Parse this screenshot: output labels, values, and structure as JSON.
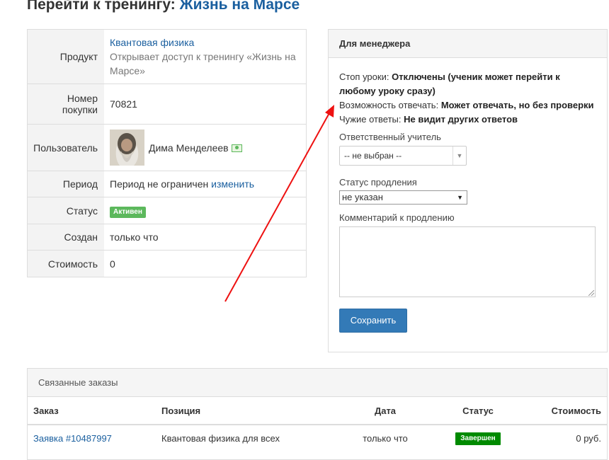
{
  "title": {
    "prefix": "Перейти к тренингу:",
    "link": "Жизнь на Марсе"
  },
  "info": {
    "product_label": "Продукт",
    "product_link": "Квантовая физика",
    "product_desc": "Открывает доступ к тренингу «Жизнь на Марсе»",
    "number_label": "Номер покупки",
    "number_value": "70821",
    "user_label": "Пользователь",
    "user_name": "Дима Менделеев",
    "period_label": "Период",
    "period_value": "Период не ограничен",
    "period_change_link": "изменить",
    "status_label": "Статус",
    "status_badge": "Активен",
    "created_label": "Создан",
    "created_value": "только что",
    "cost_label": "Стоимость",
    "cost_value": "0"
  },
  "manager": {
    "heading": "Для менеджера",
    "stop_lessons_label": "Стоп уроки:",
    "stop_lessons_value": "Отключены (ученик может перейти к любому уроку сразу)",
    "reply_label": "Возможность отвечать:",
    "reply_value": "Может отвечать, но без проверки",
    "foreign_label": "Чужие ответы:",
    "foreign_value": "Не видит других ответов",
    "teacher_label": "Ответственный учитель",
    "teacher_value": "-- не выбран --",
    "renewal_label": "Статус продления",
    "renewal_value": "не указан",
    "comment_label": "Комментарий к продлению",
    "comment_value": "",
    "save_button": "Сохранить"
  },
  "orders": {
    "heading": "Связанные заказы",
    "columns": [
      "Заказ",
      "Позиция",
      "Дата",
      "Статус",
      "Стоимость"
    ],
    "rows": [
      {
        "order": "Заявка #10487997",
        "position": "Квантовая физика для всех",
        "date": "только что",
        "status": "Завершен",
        "cost": "0 руб."
      }
    ]
  },
  "colors": {
    "link": "#1a5f9f",
    "active_badge": "#5cb85c",
    "done_badge": "#008a00",
    "primary_button": "#337ab7",
    "annotation_arrow": "#ee1111"
  }
}
